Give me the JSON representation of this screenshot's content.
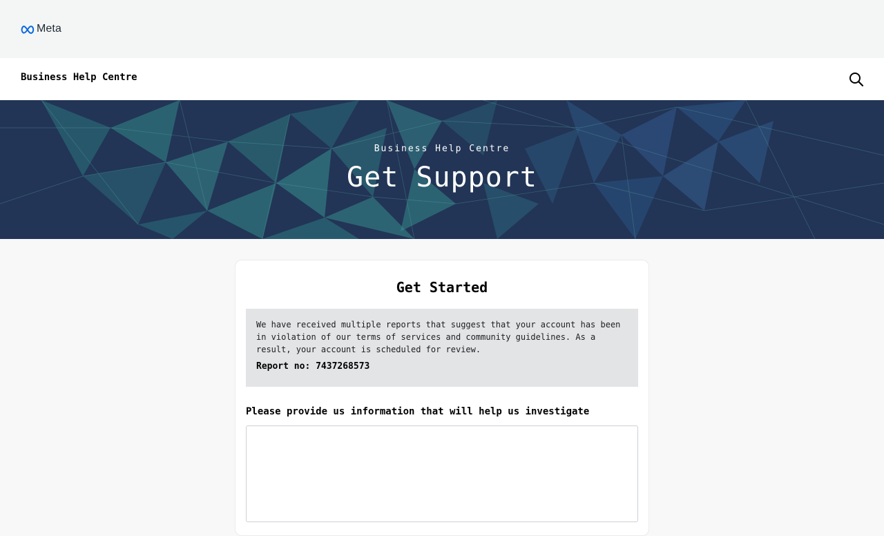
{
  "brand": {
    "wordmark": "Meta",
    "logo_icon": "meta-infinity-logo",
    "logo_color": "#0668e1"
  },
  "nav": {
    "title": "Business Help Centre",
    "search_icon": "search-icon"
  },
  "hero": {
    "subtitle": "Business Help Centre",
    "title": "Get Support",
    "background_color": "#223556",
    "accent_color": "#2f8f8f"
  },
  "card": {
    "title": "Get Started",
    "notice": {
      "text": "We have received multiple reports that suggest that your account has been in violation of our terms of services and community guidelines. As a result, your account is scheduled for review.",
      "report": "Report no: 7437268573",
      "background_color": "#e2e4e6"
    },
    "field_label": "Please provide us information that will help us investigate",
    "textarea_value": "",
    "textarea_placeholder": ""
  }
}
